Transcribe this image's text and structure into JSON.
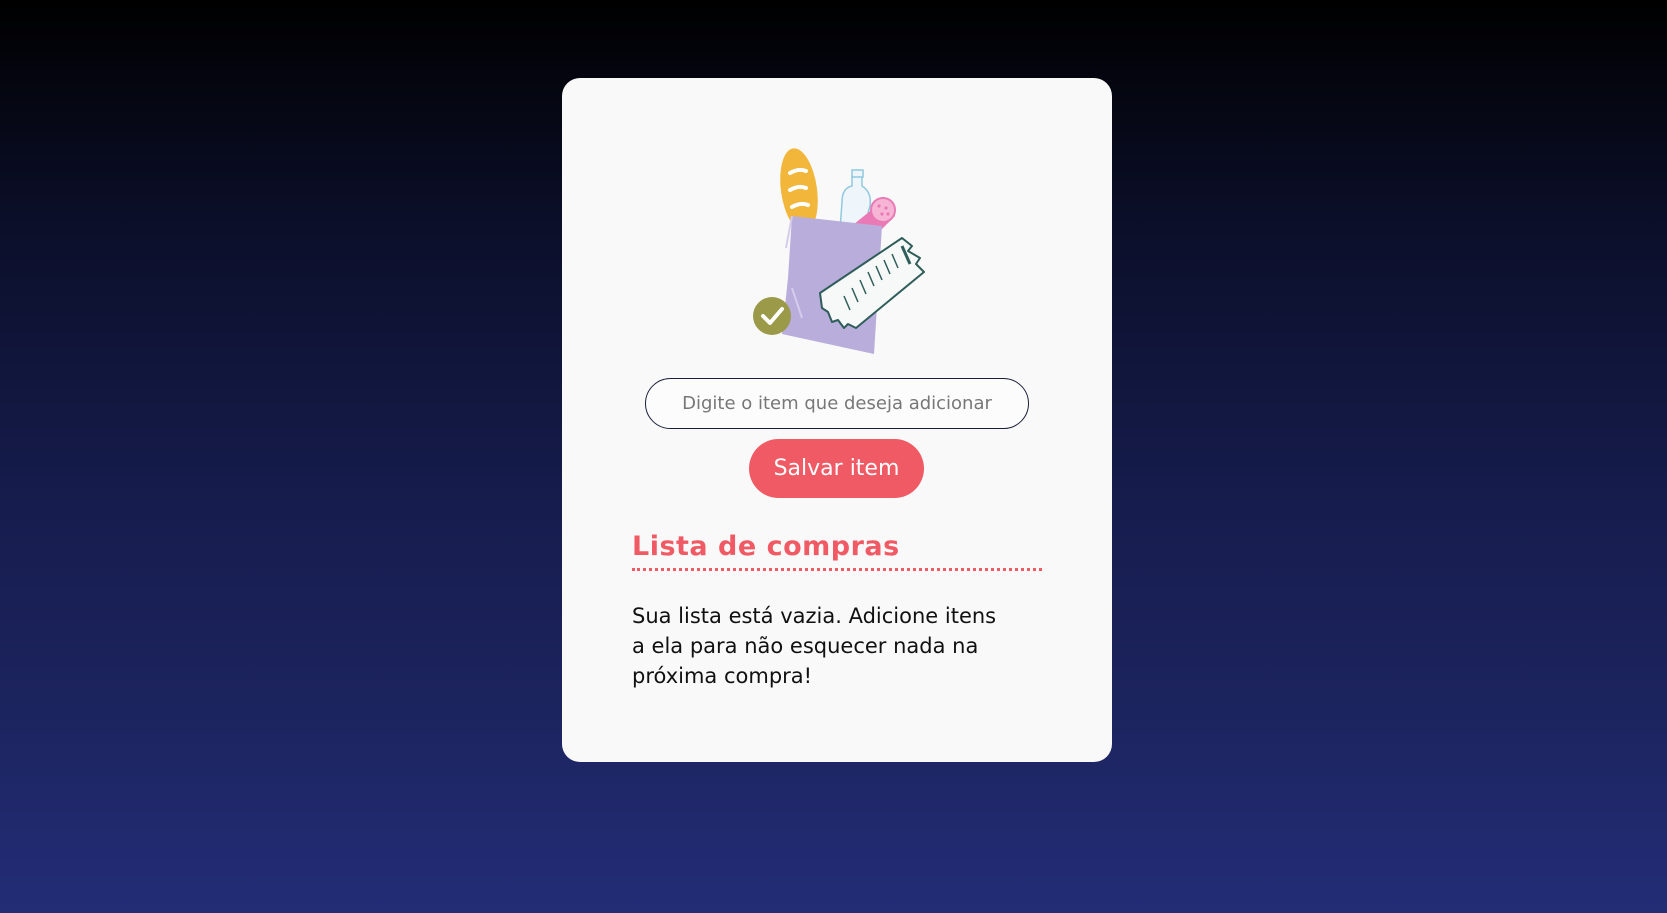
{
  "input": {
    "placeholder": "Digite o item que deseja adicionar",
    "value": ""
  },
  "save_button": {
    "label": "Salvar item"
  },
  "list": {
    "title": "Lista de compras",
    "empty_message": "Sua lista está vazia. Adicione itens a ela para não esquecer nada na próxima compra!"
  },
  "illustration": {
    "icon": "grocery-bag-icon"
  },
  "colors": {
    "accent": "#f05a64",
    "card_bg": "#f9f9f9",
    "bag": "#b9addb",
    "bread": "#f2b63a",
    "check_badge": "#9a9a48"
  }
}
